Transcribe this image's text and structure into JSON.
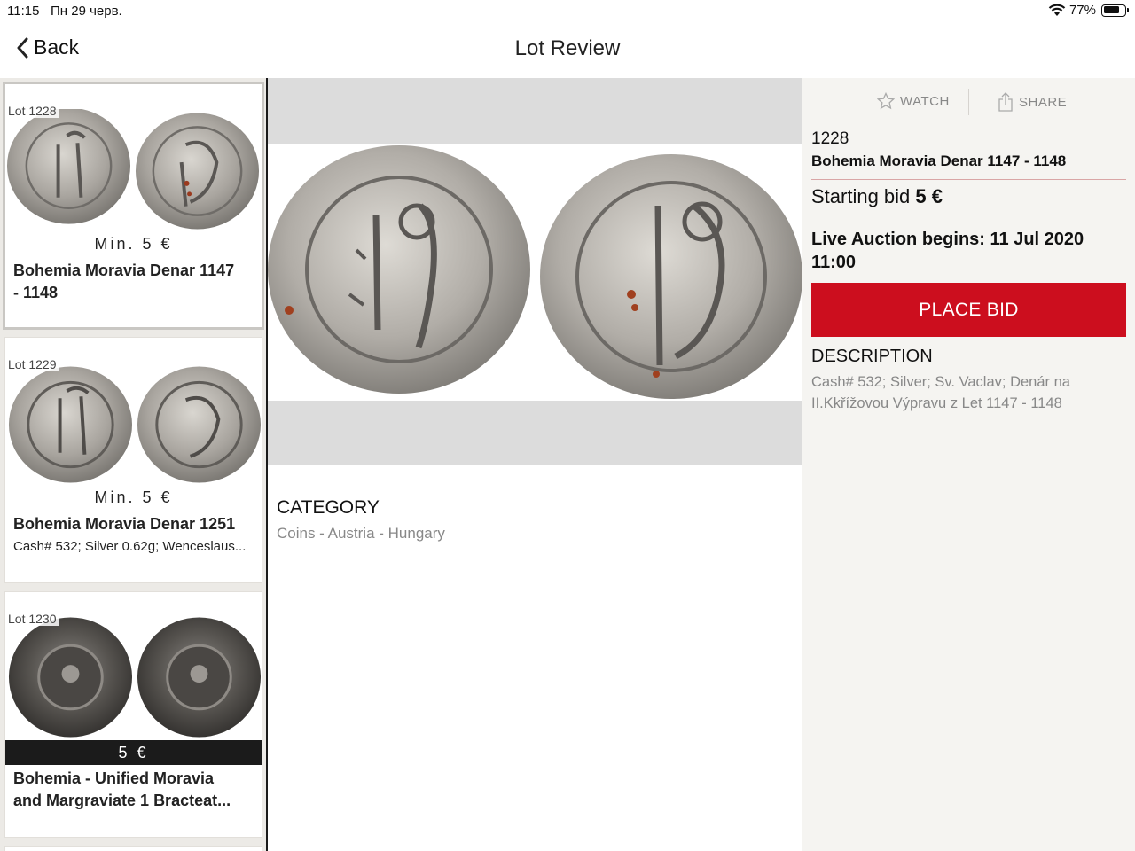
{
  "status_bar": {
    "time": "11:15",
    "date": "Пн 29 черв.",
    "battery_percent": "77%",
    "battery_level": 0.77
  },
  "nav": {
    "back_label": "Back",
    "title": "Lot Review"
  },
  "lots": [
    {
      "lot_label": "Lot 1228",
      "price": "Min. 5 €",
      "title_line1": "Bohemia Moravia Denar 1147",
      "title_line2": "- 1148",
      "selected": true
    },
    {
      "lot_label": "Lot 1229",
      "price": "Min. 5 €",
      "title_line1": "Bohemia Moravia Denar 1251",
      "subtitle": "Cash# 532; Silver 0.62g; Wenceslaus..."
    },
    {
      "lot_label": "Lot 1230",
      "price": "5 €",
      "title_line1": "Bohemia - Unified Moravia",
      "title_line2": "and Margraviate 1 Bracteat..."
    }
  ],
  "detail": {
    "watch_label": "WATCH",
    "share_label": "SHARE",
    "lot_number": "1228",
    "lot_title": "Bohemia Moravia Denar 1147 - 1148",
    "starting_bid_label": "Starting bid",
    "starting_bid_value": "5 €",
    "live_auction_line1": "Live Auction begins: 11 Jul 2020",
    "live_auction_line2": "11:00",
    "place_bid_label": "PLACE BID",
    "description_heading": "DESCRIPTION",
    "description_line1": "Cash# 532; Silver; Sv. Vaclav; Denár na",
    "description_line2": "II.Kkřížovou Výpravu z Let 1147 - 1148",
    "category_heading": "CATEGORY",
    "category_value": "Coins - Austria - Hungary"
  },
  "colors": {
    "accent_red": "#cc0e1e",
    "panel_bg": "#f5f4f1",
    "sidebar_bg": "#eceae6"
  }
}
